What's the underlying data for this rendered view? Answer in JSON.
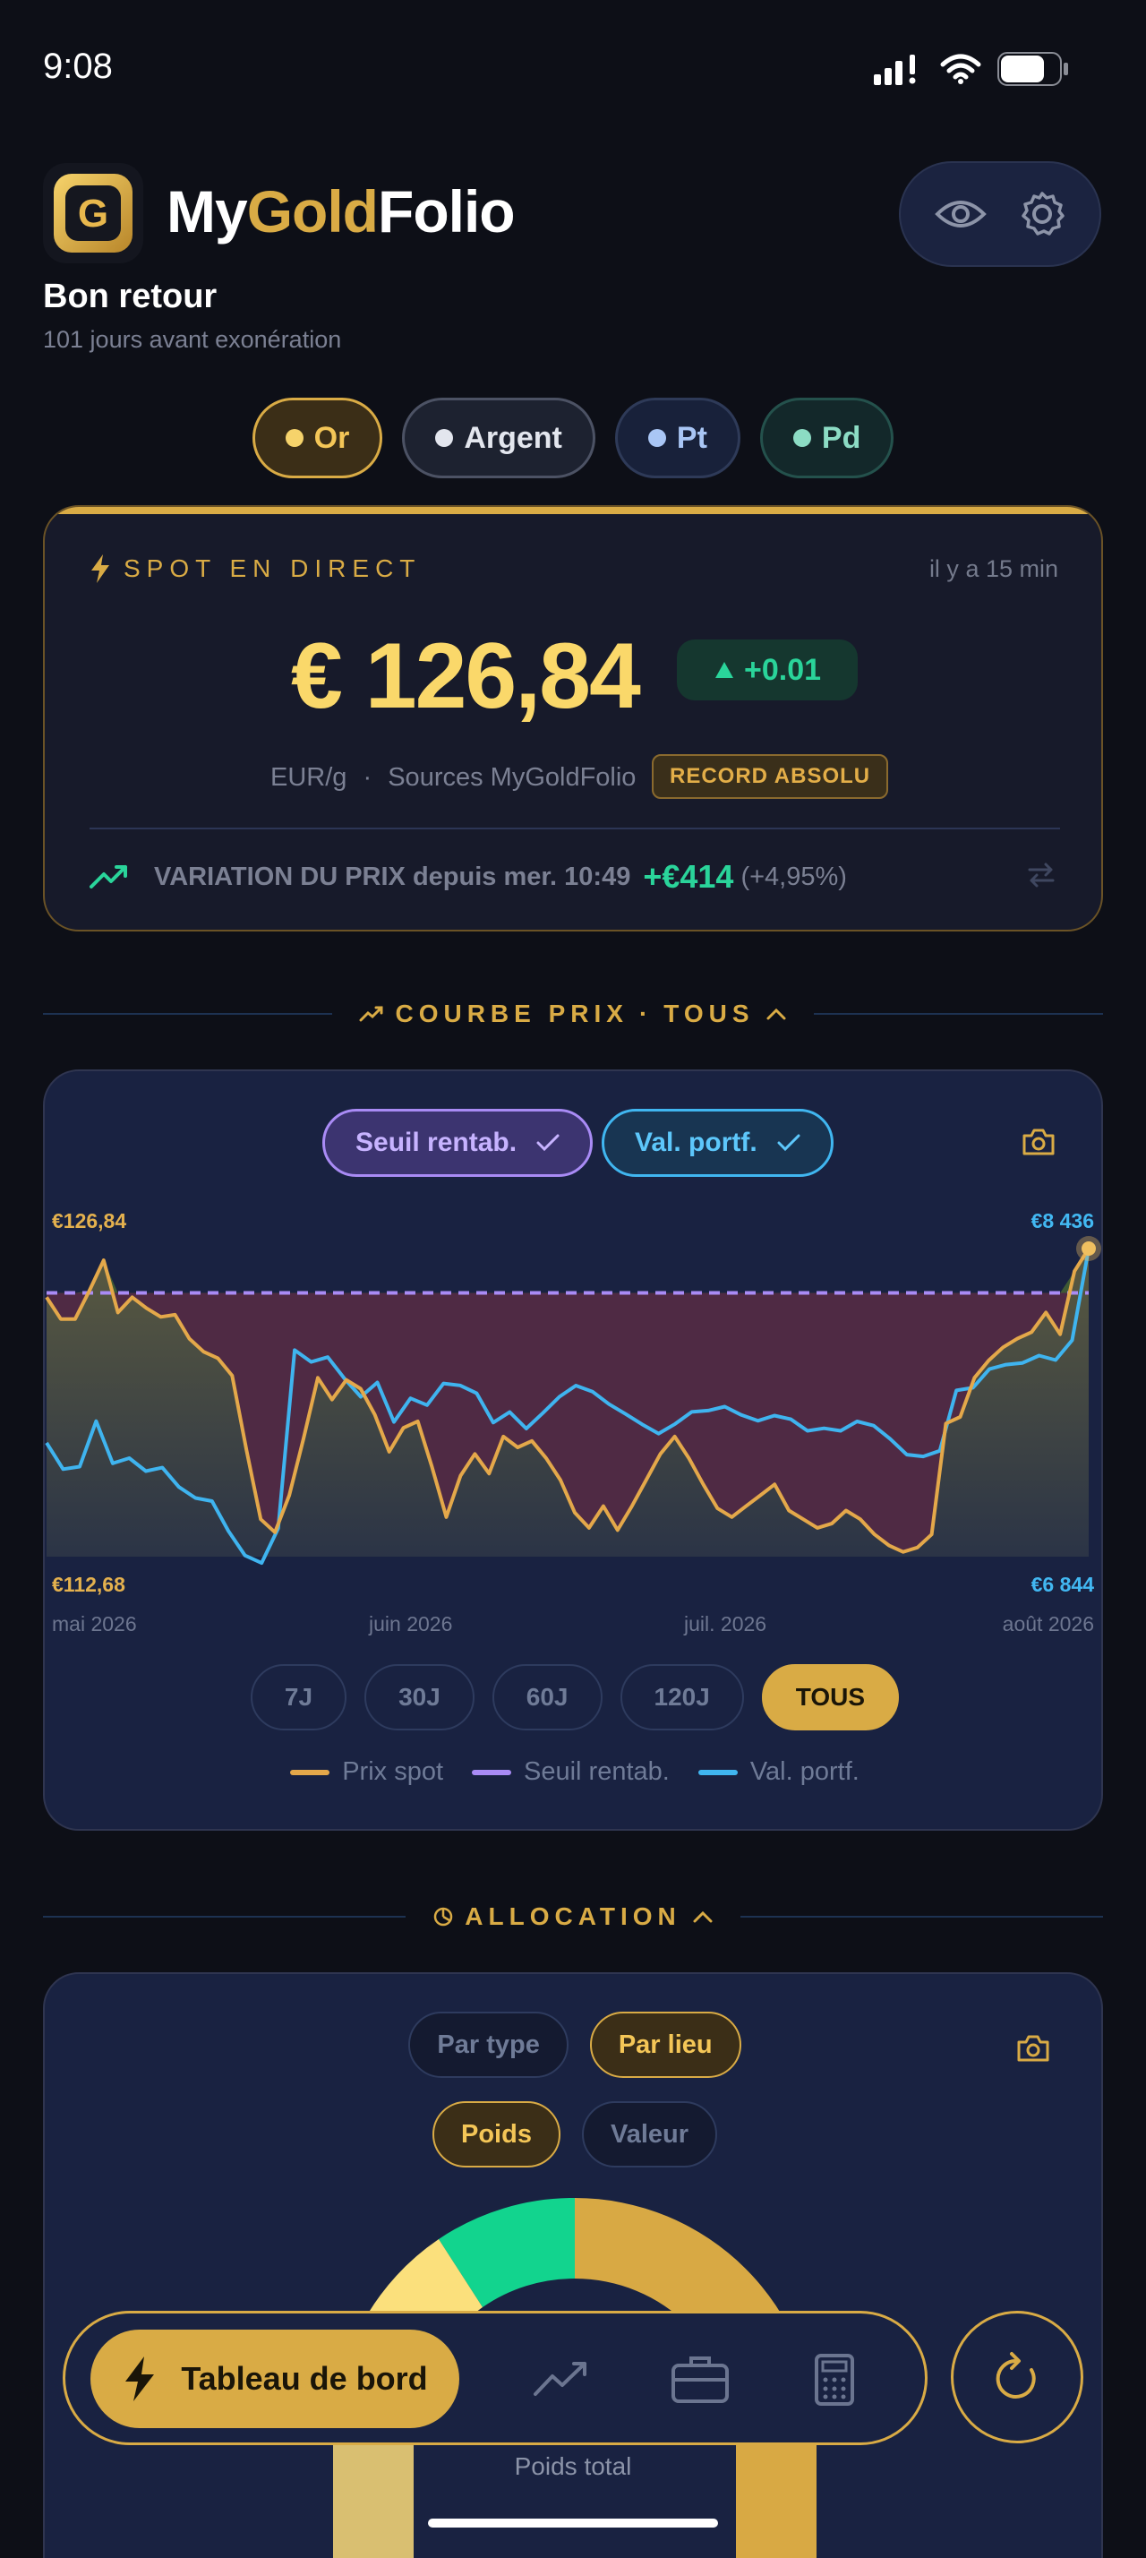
{
  "status_bar": {
    "time": "9:08"
  },
  "header": {
    "brand_part1": "My",
    "brand_part2": "Gold",
    "brand_part3": "Folio",
    "logo_letter": "G",
    "welcome": "Bon retour",
    "subtitle": "101 jours avant exonération"
  },
  "metals": [
    {
      "label": "Or",
      "active": true
    },
    {
      "label": "Argent",
      "active": false
    },
    {
      "label": "Pt",
      "active": false
    },
    {
      "label": "Pd",
      "active": false
    }
  ],
  "spot": {
    "live_label": "SPOT EN DIRECT",
    "updated": "il y a 15 min",
    "price": "€ 126,84",
    "change": "+0.01",
    "unit": "EUR/g",
    "dot": "·",
    "source": "Sources MyGoldFolio",
    "record": "RECORD ABSOLU",
    "variation_label": "VARIATION DU PRIX depuis mer. 10:49",
    "variation_amount": "+€414",
    "variation_pct": "(+4,95%)"
  },
  "curve_section": {
    "title": "COURBE PRIX",
    "dot": "·",
    "range": "TOUS"
  },
  "chart_controls": {
    "toggle_breakeven": "Seuil rentab.",
    "toggle_portfolio": "Val. portf.",
    "ranges": [
      "7J",
      "30J",
      "60J",
      "120J",
      "TOUS"
    ],
    "active_range": "TOUS",
    "legend": [
      "Prix spot",
      "Seuil rentab.",
      "Val. portf."
    ]
  },
  "chart_data": {
    "type": "line",
    "x_labels": [
      "mai 2026",
      "juin 2026",
      "juil. 2026",
      "août 2026"
    ],
    "left_axis": {
      "max_label": "€126,84",
      "min_label": "€112,68",
      "range": [
        112.68,
        126.84
      ]
    },
    "right_axis": {
      "max_label": "€8 436",
      "min_label": "€6 844",
      "range": [
        6844,
        8436
      ]
    },
    "breakeven_level": 124.8,
    "series": [
      {
        "name": "Prix spot",
        "color": "#e4a84a",
        "values": [
          124.6,
          123.6,
          123.6,
          124.9,
          126.3,
          123.9,
          124.6,
          124.1,
          123.7,
          123.8,
          122.7,
          122.1,
          121.8,
          121.0,
          117.6,
          114.4,
          113.8,
          115.5,
          118.1,
          120.9,
          119.9,
          120.8,
          120.4,
          119.2,
          117.5,
          118.6,
          118.9,
          116.8,
          114.5,
          116.4,
          117.4,
          116.5,
          118.2,
          117.7,
          118.0,
          117.2,
          116.2,
          114.7,
          114.0,
          115.0,
          113.9,
          115.0,
          116.2,
          117.4,
          118.2,
          117.2,
          116.0,
          114.9,
          114.5,
          115.0,
          115.5,
          116.0,
          114.8,
          114.4,
          114.0,
          114.2,
          114.8,
          114.4,
          113.7,
          113.2,
          112.9,
          113.1,
          113.7,
          118.8,
          119.1,
          120.9,
          121.7,
          122.3,
          122.7,
          123.0,
          123.9,
          122.9,
          125.8,
          126.84
        ]
      },
      {
        "name": "Val. portf.",
        "color": "#3fb4ef",
        "values": [
          7432,
          7296,
          7309,
          7544,
          7326,
          7353,
          7286,
          7304,
          7204,
          7147,
          7131,
          6976,
          6850,
          6811,
          6990,
          7911,
          7850,
          7875,
          7765,
          7670,
          7744,
          7540,
          7662,
          7627,
          7739,
          7729,
          7688,
          7537,
          7591,
          7506,
          7586,
          7670,
          7728,
          7697,
          7632,
          7581,
          7528,
          7480,
          7530,
          7592,
          7599,
          7619,
          7576,
          7546,
          7573,
          7554,
          7494,
          7507,
          7494,
          7543,
          7521,
          7452,
          7371,
          7362,
          7391,
          7703,
          7717,
          7813,
          7836,
          7845,
          7883,
          7860,
          7962,
          8436
        ]
      }
    ]
  },
  "allocation_section": {
    "title": "ALLOCATION"
  },
  "allocation": {
    "group_options": [
      "Par type",
      "Par lieu"
    ],
    "active_group": "Par lieu",
    "metric_options": [
      "Poids",
      "Valeur"
    ],
    "active_metric": "Poids",
    "total_label": "Poids total"
  },
  "nav": {
    "dashboard": "Tableau de bord"
  },
  "colors": {
    "accent_gold": "#d9ab45",
    "positive": "#2ad49a",
    "breakeven": "#a98bf5",
    "portfolio": "#40b6f0"
  }
}
